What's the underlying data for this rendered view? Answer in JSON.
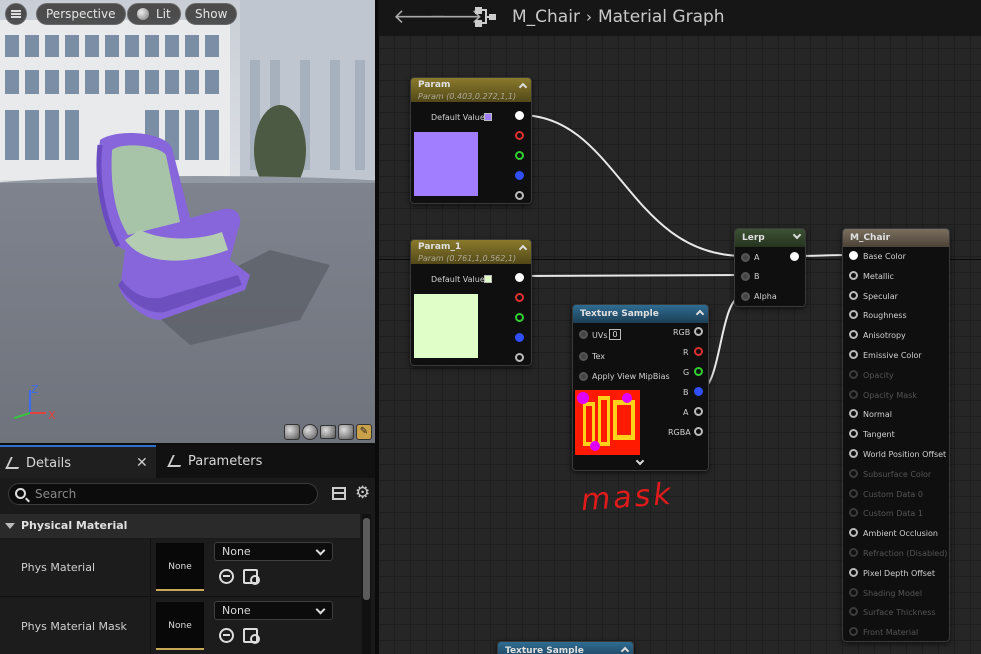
{
  "viewport": {
    "perspective_label": "Perspective",
    "lit_label": "Lit",
    "show_label": "Show",
    "axis_z": "Z",
    "axis_x": "X"
  },
  "details": {
    "tab_details": "Details",
    "tab_parameters": "Parameters",
    "search_placeholder": "Search",
    "category": "Physical Material",
    "rows": [
      {
        "label": "Phys Material",
        "thumb": "None",
        "combo": "None"
      },
      {
        "label": "Phys Material Mask",
        "thumb": "None",
        "combo": "None"
      }
    ]
  },
  "graph": {
    "breadcrumb": [
      "M_Chair",
      "Material Graph"
    ],
    "nodes": {
      "param": {
        "title": "Param",
        "subtitle": "Param (0.403,0.272,1,1)",
        "default_label": "Default Value",
        "color": "#a07eff"
      },
      "param1": {
        "title": "Param_1",
        "subtitle": "Param (0.761,1,0.562,1)",
        "default_label": "Default Value",
        "color": "#e0ffc8"
      },
      "texture": {
        "title": "Texture Sample",
        "inputs": [
          "UVs",
          "Tex",
          "Apply View MipBias"
        ],
        "uv_value": "0",
        "outputs": [
          "RGB",
          "R",
          "G",
          "B",
          "A",
          "RGBA"
        ]
      },
      "lerp": {
        "title": "Lerp",
        "inputs": [
          "A",
          "B",
          "Alpha"
        ]
      },
      "material": {
        "title": "M_Chair",
        "inputs": [
          {
            "label": "Base Color",
            "enabled": true
          },
          {
            "label": "Metallic",
            "enabled": true
          },
          {
            "label": "Specular",
            "enabled": true
          },
          {
            "label": "Roughness",
            "enabled": true
          },
          {
            "label": "Anisotropy",
            "enabled": true
          },
          {
            "label": "Emissive Color",
            "enabled": true
          },
          {
            "label": "Opacity",
            "enabled": false
          },
          {
            "label": "Opacity Mask",
            "enabled": false
          },
          {
            "label": "Normal",
            "enabled": true
          },
          {
            "label": "Tangent",
            "enabled": true
          },
          {
            "label": "World Position Offset",
            "enabled": true
          },
          {
            "label": "Subsurface Color",
            "enabled": false
          },
          {
            "label": "Custom Data 0",
            "enabled": false
          },
          {
            "label": "Custom Data 1",
            "enabled": false
          },
          {
            "label": "Ambient Occlusion",
            "enabled": true
          },
          {
            "label": "Refraction (Disabled)",
            "enabled": false
          },
          {
            "label": "Pixel Depth Offset",
            "enabled": true
          },
          {
            "label": "Shading Model",
            "enabled": false
          },
          {
            "label": "Surface Thickness",
            "enabled": false
          },
          {
            "label": "Front Material",
            "enabled": false
          }
        ]
      },
      "texture2": {
        "title": "Texture Sample"
      }
    },
    "annotation": "mask"
  }
}
